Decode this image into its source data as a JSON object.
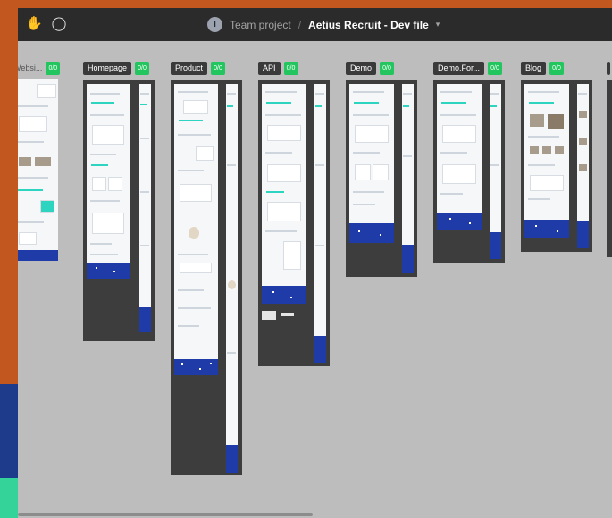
{
  "toolbar": {
    "hand_icon": "hand-icon",
    "comment_icon": "comment-icon",
    "avatar_initial": "I",
    "team": "Team project",
    "separator": "/",
    "file_name": "Aetius Recruit - Dev file",
    "chevron": "▾"
  },
  "colors": {
    "accent_green": "#22c55e",
    "footer_blue": "#1e3ba8",
    "frame_dark": "#3d3d3d",
    "canvas": "#bdbdbd",
    "border_orange": "#c2581f"
  },
  "boards": [
    {
      "name": "Websi...",
      "badge": "0/0"
    },
    {
      "name": "Homepage",
      "badge": "0/0"
    },
    {
      "name": "Product",
      "badge": "0/0"
    },
    {
      "name": "API",
      "badge": "0/0"
    },
    {
      "name": "Demo",
      "badge": "0/0"
    },
    {
      "name": "Demo.For...",
      "badge": "0/0"
    },
    {
      "name": "Blog",
      "badge": "0/0"
    }
  ]
}
